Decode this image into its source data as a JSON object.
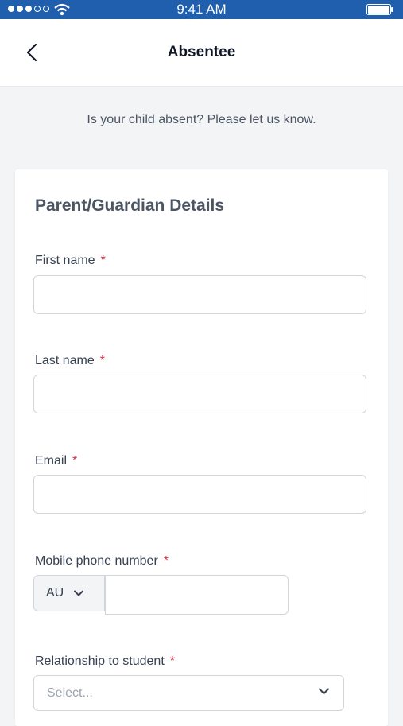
{
  "status_bar": {
    "time": "9:41 AM"
  },
  "header": {
    "title": "Absentee"
  },
  "subtitle": "Is your child absent? Please let us know.",
  "card": {
    "title": "Parent/Guardian Details",
    "required_mark": "*",
    "fields": {
      "first_name": {
        "label": "First name",
        "value": ""
      },
      "last_name": {
        "label": "Last name",
        "value": ""
      },
      "email": {
        "label": "Email",
        "value": ""
      },
      "mobile": {
        "label": "Mobile phone number",
        "country_code": "AU",
        "value": ""
      },
      "relationship": {
        "label": "Relationship to student",
        "placeholder": "Select..."
      }
    }
  },
  "colors": {
    "status_bar": "#1f5fae",
    "required": "#d0304b",
    "background": "#f3f4f6"
  },
  "icons": [
    "signal-dots-icon",
    "wifi-icon",
    "battery-icon",
    "back-arrow-icon",
    "chevron-down-icon"
  ]
}
